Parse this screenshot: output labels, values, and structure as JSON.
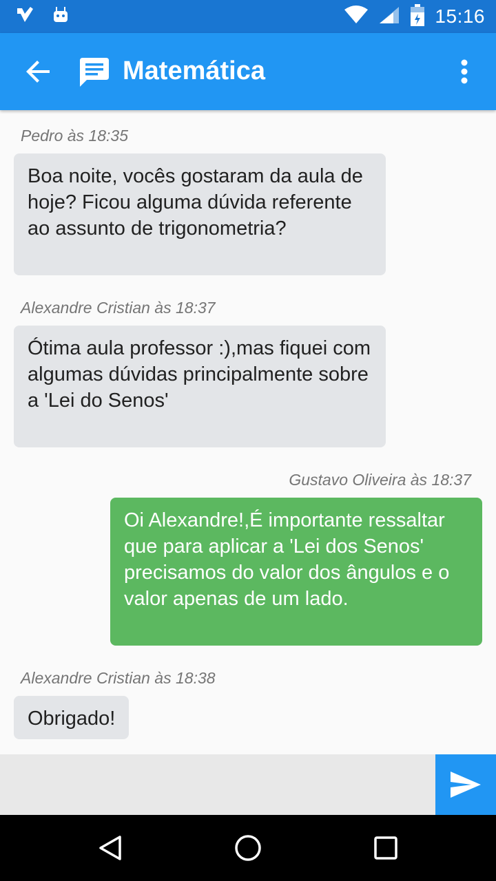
{
  "status_bar": {
    "time": "15:16",
    "icons": [
      "notification-icon",
      "android-icon",
      "wifi-icon",
      "signal-icon",
      "battery-icon"
    ]
  },
  "app_bar": {
    "title": "Matemática",
    "icons": [
      "back-arrow-icon",
      "chat-icon",
      "more-vert-icon"
    ]
  },
  "messages": [
    {
      "author_time": "Pedro às 18:35",
      "text": "Boa noite, vocês gostaram da aula de hoje? Ficou alguma dúvida referente ao assunto de trigonometria?",
      "direction": "incoming"
    },
    {
      "author_time": "Alexandre Cristian às 18:37",
      "text": "Ótima aula professor :),mas fiquei com algumas dúvidas principalmente sobre a 'Lei do Senos'",
      "direction": "incoming"
    },
    {
      "author_time": "Gustavo Oliveira às 18:37",
      "text": "Oi Alexandre!,É importante ressaltar que para aplicar a 'Lei dos Senos' precisamos do valor dos ângulos e o valor apenas de um lado.",
      "direction": "outgoing"
    },
    {
      "author_time": "Alexandre Cristian às 18:38",
      "text": "Obrigado!",
      "direction": "incoming"
    }
  ],
  "input": {
    "value": "",
    "placeholder": ""
  },
  "send": {
    "icon": "send-icon"
  },
  "nav_bar": {
    "icons": [
      "back-triangle-icon",
      "home-circle-icon",
      "recents-square-icon"
    ]
  },
  "colors": {
    "status_bar": "#1976d2",
    "app_bar": "#2196f3",
    "incoming_bubble": "#e3e5e8",
    "outgoing_bubble": "#5cb860",
    "send_button": "#2196f3"
  }
}
